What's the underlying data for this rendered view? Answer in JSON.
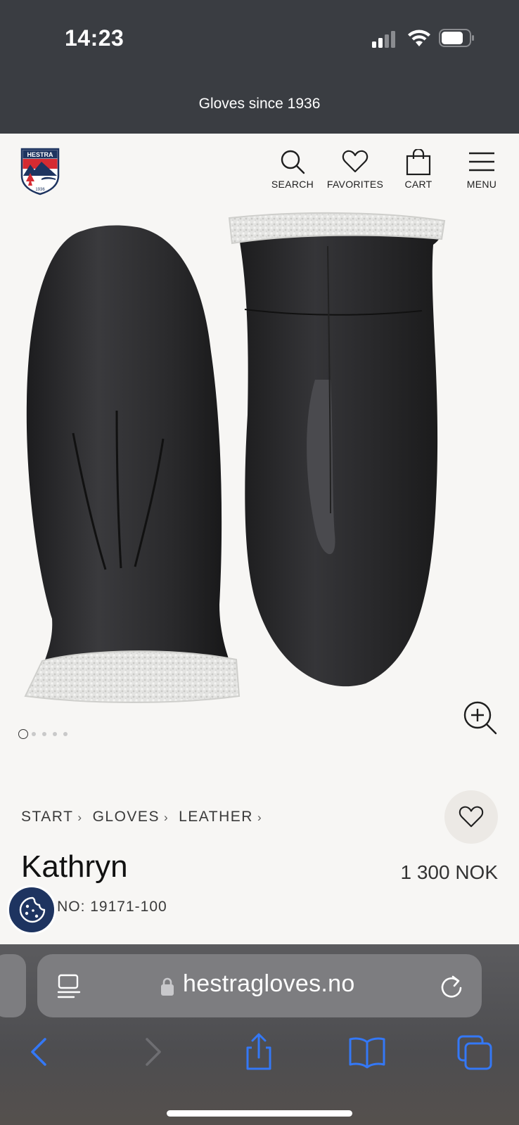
{
  "status_bar": {
    "time": "14:23"
  },
  "promo_bar": {
    "text": "Gloves since 1936"
  },
  "header": {
    "logo_text": "HESTRA",
    "logo_year": "1936",
    "nav": {
      "search": "SEARCH",
      "favorites": "FAVORITES",
      "cart": "CART",
      "menu": "MENU"
    }
  },
  "gallery": {
    "image_count": 5,
    "active_index": 0
  },
  "breadcrumb": {
    "items": [
      "START",
      "GLOVES",
      "LEATHER"
    ],
    "separator": "›"
  },
  "product": {
    "name": "Kathryn",
    "price": "1 300 NOK",
    "art_no": "ART NO: 19171-100"
  },
  "browser": {
    "url": "hestragloves.no"
  },
  "colors": {
    "status_bg": "#3a3d42",
    "page_bg": "#f7f6f4",
    "cookie_bg": "#1e3460",
    "ios_blue": "#3478f6"
  },
  "icons": [
    "search-icon",
    "heart-icon",
    "bag-icon",
    "hamburger-icon",
    "zoom-in-icon",
    "cookie-icon",
    "lock-icon",
    "reader-icon",
    "reload-icon",
    "back-icon",
    "forward-icon",
    "share-icon",
    "bookmarks-icon",
    "tabs-icon"
  ]
}
